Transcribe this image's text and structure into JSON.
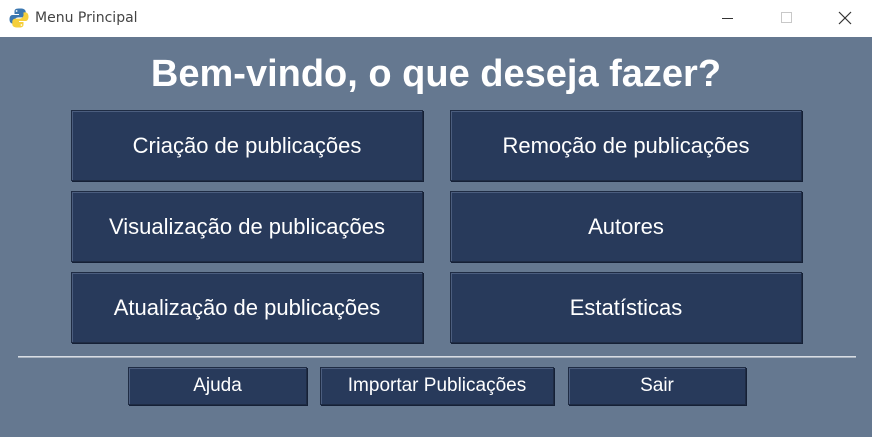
{
  "window": {
    "title": "Menu Principal",
    "icon": "python-icon",
    "controls": [
      "minimize-icon",
      "maximize-icon",
      "close-icon"
    ]
  },
  "main": {
    "heading": "Bem-vindo, o que deseja fazer?",
    "buttons": [
      {
        "label": "Criação de publicações"
      },
      {
        "label": "Remoção de publicações"
      },
      {
        "label": "Visualização de publicações"
      },
      {
        "label": "Autores"
      },
      {
        "label": "Atualização de publicações"
      },
      {
        "label": "Estatísticas"
      }
    ]
  },
  "footer": {
    "help_label": "Ajuda",
    "import_label": "Importar Publicações",
    "exit_label": "Sair"
  },
  "colors": {
    "background": "#657890",
    "button": "#283a5b",
    "text": "#ffffff"
  }
}
